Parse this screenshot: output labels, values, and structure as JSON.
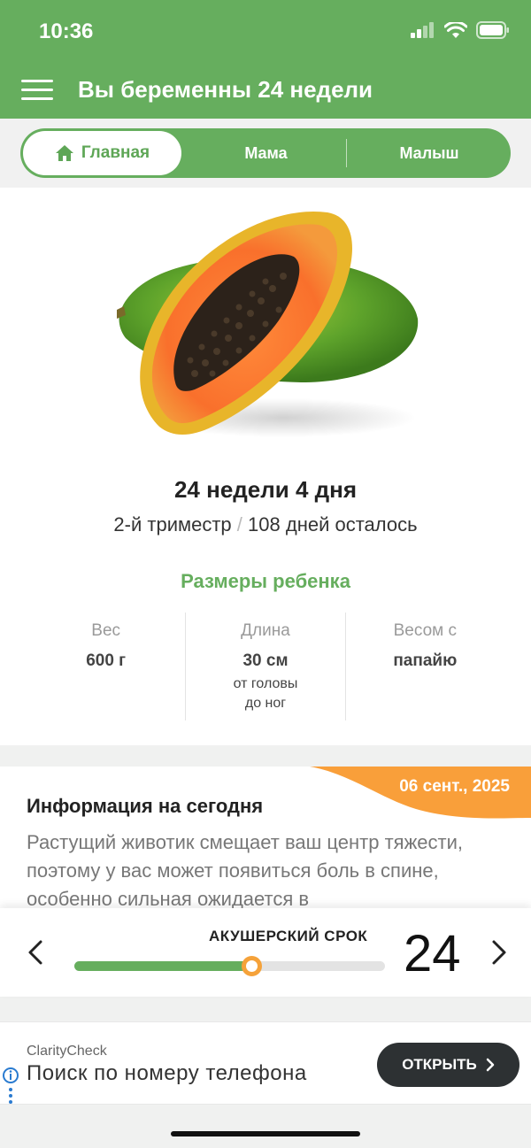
{
  "status_bar": {
    "time": "10:36"
  },
  "app_bar": {
    "title": "Вы беременны 24 недели"
  },
  "tabs": {
    "home": "Главная",
    "mom": "Мама",
    "baby": "Малыш"
  },
  "pregnancy": {
    "week_title": "24 недели 4 дня",
    "trimester": "2-й триместр",
    "separator": "/",
    "days_left": "108 дней осталось"
  },
  "baby_size": {
    "heading": "Размеры ребенка",
    "weight": {
      "label": "Вес",
      "value": "600 г"
    },
    "length": {
      "label": "Длина",
      "value": "30 см",
      "note_line1": "от головы",
      "note_line2": "до ног"
    },
    "compare": {
      "label": "Весом с",
      "value": "папайю"
    }
  },
  "today_info": {
    "date": "06 сент., 2025",
    "title": "Информация на сегодня",
    "text": "Растущий животик смещает ваш центр тяжести, поэтому у вас может появиться боль в спине, особенно сильная ожидается в"
  },
  "term_slider": {
    "label": "АКУШЕРСКИЙ СРОК",
    "week": "24",
    "progress_fraction": 0.57
  },
  "ad": {
    "brand": "ClarityCheck",
    "text": "Поиск по номеру телефона",
    "button": "ОТКРЫТЬ"
  },
  "colors": {
    "brand_green": "#66ae5e",
    "accent_orange": "#f5a23a",
    "ad_button": "#2d3133"
  },
  "icons": [
    "signal-icon",
    "wifi-icon",
    "battery-icon",
    "menu-icon",
    "home-icon",
    "chevron-left-icon",
    "chevron-right-icon",
    "info-icon"
  ]
}
